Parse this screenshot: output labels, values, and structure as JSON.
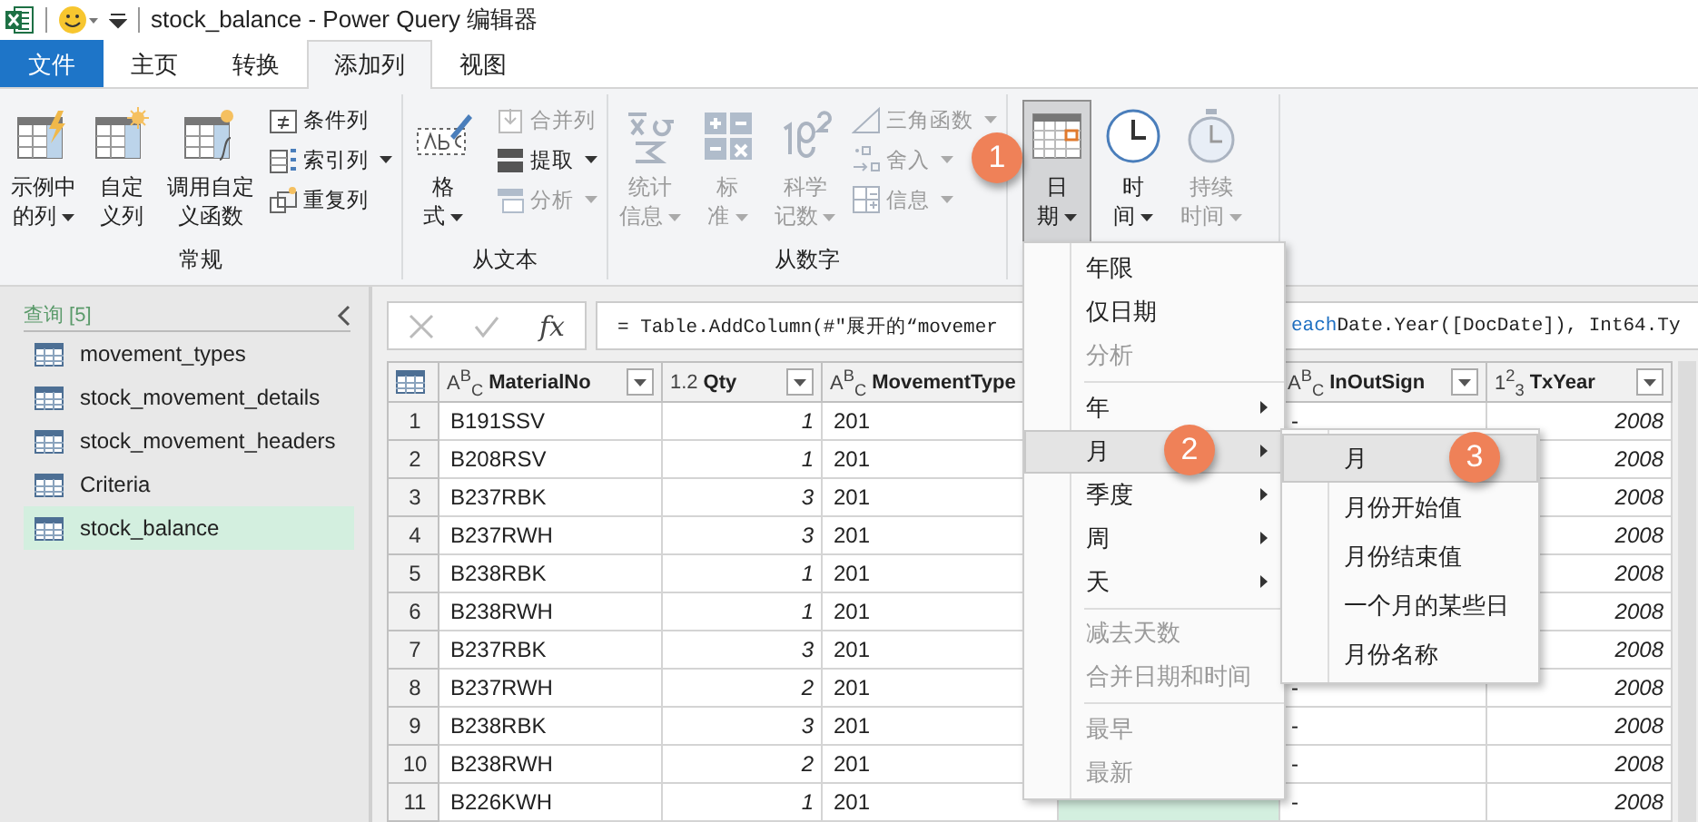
{
  "title_bar": {
    "title": "stock_balance - Power Query 编辑器"
  },
  "tabs": [
    {
      "label": "文件",
      "kind": "file",
      "selected": false
    },
    {
      "label": "主页",
      "kind": "tab",
      "selected": false
    },
    {
      "label": "转换",
      "kind": "tab",
      "selected": false
    },
    {
      "label": "添加列",
      "kind": "tab",
      "selected": true
    },
    {
      "label": "视图",
      "kind": "tab",
      "selected": false
    }
  ],
  "ribbon": {
    "groups": [
      {
        "label": "常规",
        "items": [
          {
            "kind": "large",
            "lines": [
              "示例中",
              "的列"
            ],
            "dropdown": true,
            "disabled": false,
            "pressed": false
          },
          {
            "kind": "large",
            "lines": [
              "自定",
              "义列"
            ],
            "dropdown": false,
            "disabled": false,
            "pressed": false
          },
          {
            "kind": "large",
            "lines": [
              "调用自定",
              "义函数"
            ],
            "dropdown": false,
            "disabled": false,
            "pressed": false
          },
          {
            "kind": "stack",
            "buttons": [
              {
                "label": "条件列",
                "dropdown": false,
                "disabled": false
              },
              {
                "label": "索引列",
                "dropdown": true,
                "disabled": false
              },
              {
                "label": "重复列",
                "dropdown": false,
                "disabled": false
              }
            ]
          }
        ]
      },
      {
        "label": "从文本",
        "items": [
          {
            "kind": "large",
            "lines": [
              "格",
              "式"
            ],
            "dropdown": true,
            "disabled": false,
            "pressed": false
          },
          {
            "kind": "stack",
            "buttons": [
              {
                "label": "合并列",
                "dropdown": false,
                "disabled": true
              },
              {
                "label": "提取",
                "dropdown": true,
                "disabled": false
              },
              {
                "label": "分析",
                "dropdown": true,
                "disabled": true
              }
            ]
          }
        ]
      },
      {
        "label": "从数字",
        "items": [
          {
            "kind": "large",
            "lines": [
              "统计",
              "信息"
            ],
            "dropdown": true,
            "disabled": true,
            "pressed": false
          },
          {
            "kind": "large",
            "lines": [
              "标",
              "准"
            ],
            "dropdown": true,
            "disabled": true,
            "pressed": false
          },
          {
            "kind": "large",
            "lines": [
              "科学",
              "记数"
            ],
            "dropdown": true,
            "disabled": true,
            "pressed": false
          },
          {
            "kind": "stack",
            "buttons": [
              {
                "label": "三角函数",
                "dropdown": true,
                "disabled": true
              },
              {
                "label": "舍入",
                "dropdown": true,
                "disabled": true
              },
              {
                "label": "信息",
                "dropdown": true,
                "disabled": true
              }
            ]
          }
        ]
      },
      {
        "items": [
          {
            "kind": "large",
            "lines": [
              "日",
              "期"
            ],
            "dropdown": true,
            "disabled": false,
            "pressed": true
          },
          {
            "kind": "large",
            "lines": [
              "时",
              "间"
            ],
            "dropdown": true,
            "disabled": false,
            "pressed": false
          },
          {
            "kind": "large",
            "lines": [
              "持续",
              "时间"
            ],
            "dropdown": true,
            "disabled": true,
            "pressed": false
          }
        ]
      }
    ]
  },
  "queries": {
    "title": "查询 [5]",
    "items": [
      {
        "label": "movement_types",
        "selected": false
      },
      {
        "label": "stock_movement_details",
        "selected": false
      },
      {
        "label": "stock_movement_headers",
        "selected": false
      },
      {
        "label": "Criteria",
        "selected": false
      },
      {
        "label": "stock_balance",
        "selected": true
      }
    ]
  },
  "formula_bar": {
    "fx_label": "fx",
    "formula_start": "= Table.AddColumn(#\"展开的“movemer",
    "formula_keyword": "each",
    "formula_end": " Date.Year([DocDate]), Int64.Ty"
  },
  "table": {
    "columns": [
      {
        "type": "A$^{B}$$_{C}$",
        "name": "MaterialNo",
        "kind": "text",
        "filter_button": true,
        "selected": false
      },
      {
        "type": "1.2",
        "name": "Qty",
        "kind": "number",
        "filter_button": true,
        "selected": false
      },
      {
        "type": "A$^{B}$$_{C}$",
        "name": "MovementType",
        "kind": "text",
        "selected": false
      },
      {
        "kind": "text",
        "selected": true
      },
      {
        "type": "A$^{B}$$_{C}$",
        "name": "InOutSign",
        "kind": "text",
        "filter_button": true,
        "selected": false
      },
      {
        "type": "1$^{2}$$_{3}$",
        "name": "TxYear",
        "kind": "number",
        "filter_button": true,
        "selected": false
      }
    ],
    "rows": [
      {
        "n": "1",
        "cells": [
          "B191SSV",
          "1",
          "201",
          null,
          "-",
          "2008"
        ]
      },
      {
        "n": "2",
        "cells": [
          "B208RSV",
          "1",
          "201",
          null,
          null,
          "2008"
        ]
      },
      {
        "n": "3",
        "cells": [
          "B237RBK",
          "3",
          "201",
          null,
          null,
          "2008"
        ]
      },
      {
        "n": "4",
        "cells": [
          "B237RWH",
          "3",
          "201",
          null,
          null,
          "2008"
        ]
      },
      {
        "n": "5",
        "cells": [
          "B238RBK",
          "1",
          "201",
          null,
          null,
          "2008"
        ]
      },
      {
        "n": "6",
        "cells": [
          "B238RWH",
          "1",
          "201",
          null,
          null,
          "2008"
        ]
      },
      {
        "n": "7",
        "cells": [
          "B237RBK",
          "3",
          "201",
          null,
          null,
          "2008"
        ]
      },
      {
        "n": "8",
        "cells": [
          "B237RWH",
          "2",
          "201",
          null,
          "-",
          "2008"
        ]
      },
      {
        "n": "9",
        "cells": [
          "B238RBK",
          "3",
          "201",
          null,
          "-",
          "2008"
        ]
      },
      {
        "n": "10",
        "cells": [
          "B238RWH",
          "2",
          "201",
          null,
          "-",
          "2008"
        ]
      },
      {
        "n": "11",
        "cells": [
          "B226KWH",
          "1",
          "201",
          null,
          "-",
          "2008"
        ]
      }
    ]
  },
  "date_menu": {
    "items": [
      {
        "kind": "item",
        "label": "年限",
        "disabled": false,
        "submenu": false,
        "selected": false
      },
      {
        "kind": "item",
        "label": "仅日期",
        "disabled": false,
        "submenu": false,
        "selected": false
      },
      {
        "kind": "item",
        "label": "分析",
        "disabled": true,
        "submenu": false,
        "selected": false
      },
      {
        "kind": "separator"
      },
      {
        "kind": "item",
        "label": "年",
        "disabled": false,
        "submenu": true,
        "selected": false
      },
      {
        "kind": "item",
        "label": "月",
        "disabled": false,
        "submenu": true,
        "selected": true
      },
      {
        "kind": "item",
        "label": "季度",
        "disabled": false,
        "submenu": true,
        "selected": false
      },
      {
        "kind": "item",
        "label": "周",
        "disabled": false,
        "submenu": true,
        "selected": false
      },
      {
        "kind": "item",
        "label": "天",
        "disabled": false,
        "submenu": true,
        "selected": false
      },
      {
        "kind": "separator"
      },
      {
        "kind": "item",
        "label": "减去天数",
        "disabled": true,
        "submenu": false,
        "selected": false
      },
      {
        "kind": "item",
        "label": "合并日期和时间",
        "disabled": true,
        "submenu": false,
        "selected": false
      },
      {
        "kind": "separator"
      },
      {
        "kind": "item",
        "label": "最早",
        "disabled": true,
        "submenu": false,
        "selected": false
      },
      {
        "kind": "item",
        "label": "最新",
        "disabled": true,
        "submenu": false,
        "selected": false
      }
    ]
  },
  "month_submenu": {
    "items": [
      {
        "label": "月",
        "selected": true
      },
      {
        "label": "月份开始值",
        "selected": false
      },
      {
        "label": "月份结束值",
        "selected": false
      },
      {
        "label": "一个月的某些日",
        "selected": false
      },
      {
        "label": "月份名称",
        "selected": false
      }
    ]
  },
  "step_badges": [
    "1",
    "2",
    "3"
  ]
}
